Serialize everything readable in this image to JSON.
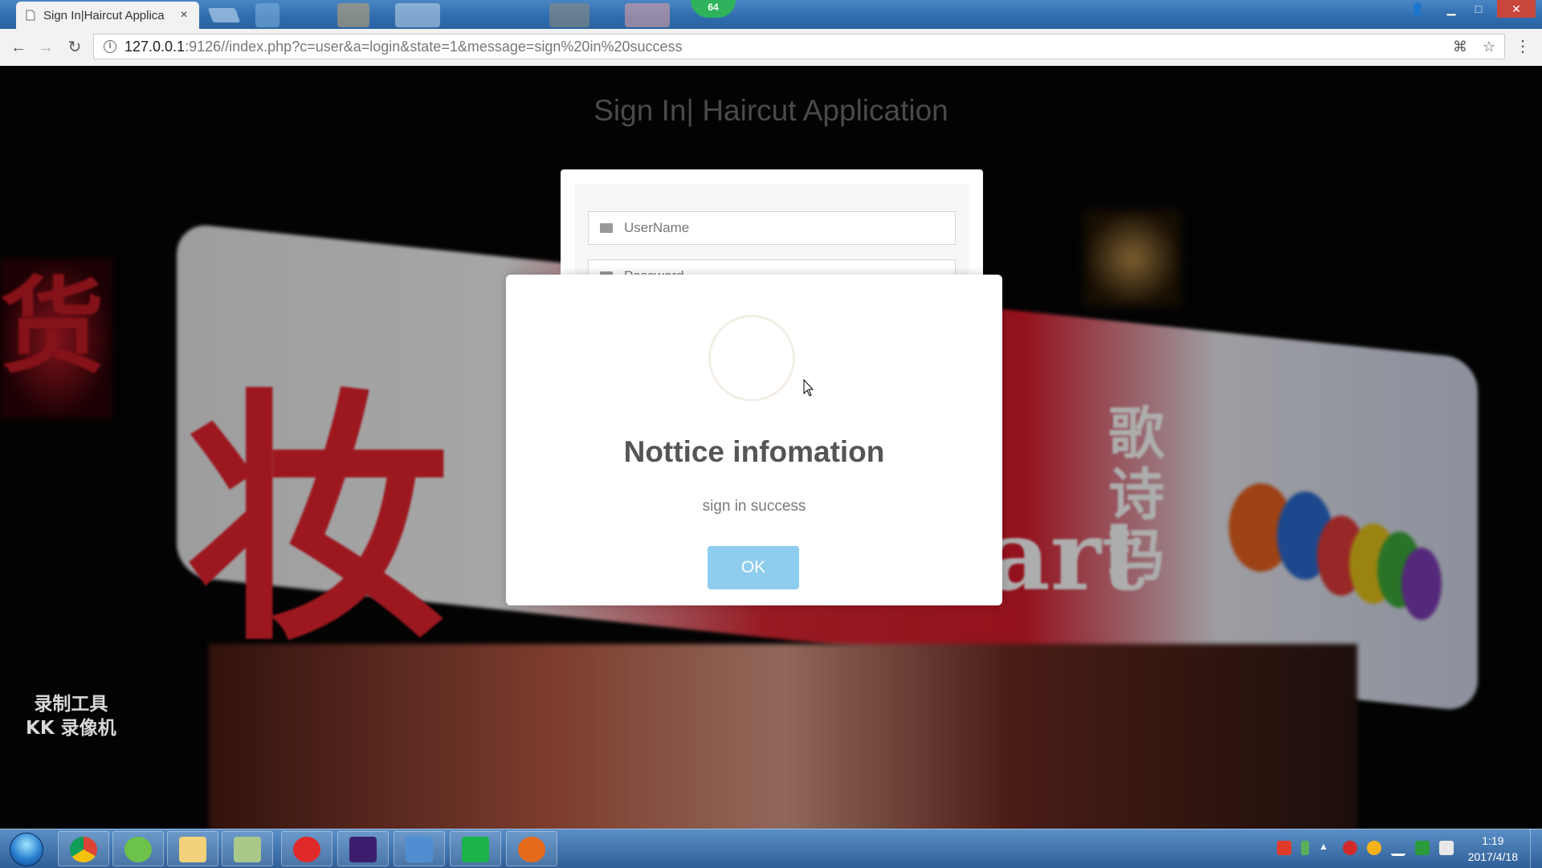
{
  "browser": {
    "tab_title": "Sign In|Haircut Applica",
    "tab_close": "×",
    "badge": "64",
    "url_host": "127.0.0.1",
    "url_rest": ":9126//index.php?c=user&a=login&state=1&message=sign%20in%20success",
    "back": "←",
    "forward": "→",
    "reload": "↻",
    "info": "i",
    "translate": "⌘",
    "star": "☆",
    "menu": "⋮",
    "min": "▁",
    "max": "□",
    "close": "✕",
    "user": "👤"
  },
  "page": {
    "title": "Sign In| Haircut Application",
    "username_placeholder": "UserName",
    "password_placeholder": "Password"
  },
  "modal": {
    "title": "Nottice infomation",
    "text": "sign in success",
    "ok_label": "OK"
  },
  "watermark": {
    "line1": "录制工具",
    "line2": "KK 录像机"
  },
  "taskbar": {
    "apps": [
      "chrome",
      "app-green",
      "file-explorer",
      "notepad",
      "netease-music",
      "phpstorm",
      "folder",
      "app-s",
      "app-mask"
    ],
    "time": "1:19",
    "date": "2017/4/18"
  },
  "colors": {
    "ok_button": "#8ecdee",
    "modal_title": "#555555",
    "page_title": "#4a4a4a"
  }
}
